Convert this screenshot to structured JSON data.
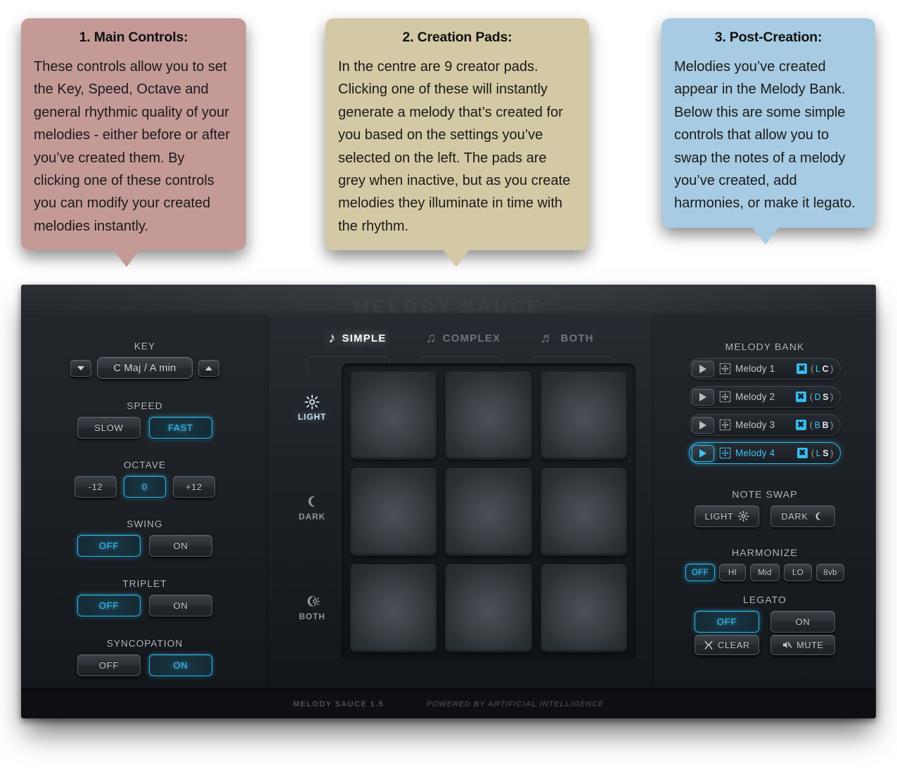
{
  "colors": {
    "accent_blue": "#3fc3f5",
    "callout1_bg": "#c49a96",
    "callout2_bg": "#d3c9a4",
    "callout3_bg": "#a7cbe2"
  },
  "callouts": [
    {
      "id": "main-controls",
      "title": "1. Main Controls:",
      "body": "These controls allow you to set the Key, Speed, Octave and general rhythmic quality of your melodies - either before or after you’ve created them. By clicking one of these controls you can modify your created melodies instantly.",
      "bg": "#c49a96"
    },
    {
      "id": "creation-pads",
      "title": "2. Creation Pads:",
      "body": "In the centre are 9 creator pads. Clicking one of these will instantly generate a melody that’s created for you based on the settings you’ve selected on the left.  The pads are grey when inactive, but as you create melodies they illuminate in time with the rhythm.",
      "bg": "#d3c9a4"
    },
    {
      "id": "post-creation",
      "title": "3. Post-Creation:",
      "body": "Melodies you’ve created appear in the Melody Bank.  Below this are some simple controls that allow you to swap the notes of a melody you’ve created, add harmonies, or make it legato.",
      "bg": "#a7cbe2"
    }
  ],
  "plugin": {
    "logo_watermark": "MELODY SAUCE",
    "footer": {
      "product": "MELODY SAUCE 1.5",
      "tagline": "POWERED BY ARTIFICIAL INTELLIGENCE"
    }
  },
  "left_panel": {
    "key": {
      "label": "KEY",
      "value": "C Maj / A min",
      "prev_icon": "triangle-down-icon",
      "next_icon": "triangle-up-icon"
    },
    "speed": {
      "label": "SPEED",
      "options": [
        "SLOW",
        "FAST"
      ],
      "selected": "FAST"
    },
    "octave": {
      "label": "OCTAVE",
      "options": [
        "-12",
        "0",
        "+12"
      ],
      "selected": "0"
    },
    "swing": {
      "label": "SWING",
      "options": [
        "OFF",
        "ON"
      ],
      "selected": "OFF"
    },
    "triplet": {
      "label": "TRIPLET",
      "options": [
        "OFF",
        "ON"
      ],
      "selected": "OFF"
    },
    "syncopation": {
      "label": "SYNCOPATION",
      "options": [
        "OFF",
        "ON"
      ],
      "selected": "ON"
    }
  },
  "center_panel": {
    "tabs": [
      {
        "label": "SIMPLE",
        "icon": "single-eighth-note-icon",
        "glyph": "♪",
        "active": true
      },
      {
        "label": "COMPLEX",
        "icon": "beamed-two-notes-icon",
        "glyph": "♫",
        "active": false
      },
      {
        "label": "BOTH",
        "icon": "beamed-three-notes-icon",
        "glyph": "♬",
        "active": false
      }
    ],
    "row_labels": [
      {
        "label": "LIGHT",
        "icon": "sun-icon",
        "lit": true
      },
      {
        "label": "DARK",
        "icon": "moon-icon",
        "lit": false
      },
      {
        "label": "BOTH",
        "icon": "sun-moon-icon",
        "lit": false
      }
    ],
    "pads": [
      {
        "id": "pad-1",
        "row": "LIGHT",
        "col": "SIMPLE",
        "state": "inactive"
      },
      {
        "id": "pad-2",
        "row": "LIGHT",
        "col": "COMPLEX",
        "state": "inactive"
      },
      {
        "id": "pad-3",
        "row": "LIGHT",
        "col": "BOTH",
        "state": "inactive"
      },
      {
        "id": "pad-4",
        "row": "DARK",
        "col": "SIMPLE",
        "state": "inactive"
      },
      {
        "id": "pad-5",
        "row": "DARK",
        "col": "COMPLEX",
        "state": "inactive"
      },
      {
        "id": "pad-6",
        "row": "DARK",
        "col": "BOTH",
        "state": "inactive"
      },
      {
        "id": "pad-7",
        "row": "BOTH",
        "col": "SIMPLE",
        "state": "inactive"
      },
      {
        "id": "pad-8",
        "row": "BOTH",
        "col": "COMPLEX",
        "state": "inactive"
      },
      {
        "id": "pad-9",
        "row": "BOTH",
        "col": "BOTH",
        "state": "inactive"
      }
    ]
  },
  "right_panel": {
    "melody_bank": {
      "label": "MELODY BANK",
      "rows": [
        {
          "name": "Melody 1",
          "tag_a": "L",
          "tag_b": "C",
          "active": false,
          "drag_icon": "drag-handle-icon",
          "play_icon": "play-icon",
          "export_icon": "midi-drag-x-icon"
        },
        {
          "name": "Melody 2",
          "tag_a": "D",
          "tag_b": "S",
          "active": false,
          "drag_icon": "drag-handle-icon",
          "play_icon": "play-icon",
          "export_icon": "midi-drag-x-icon"
        },
        {
          "name": "Melody 3",
          "tag_a": "B",
          "tag_b": "B",
          "active": false,
          "drag_icon": "drag-handle-icon",
          "play_icon": "play-icon",
          "export_icon": "midi-drag-x-icon"
        },
        {
          "name": "Melody 4",
          "tag_a": "L",
          "tag_b": "S",
          "active": true,
          "drag_icon": "drag-handle-icon",
          "play_icon": "play-icon",
          "export_icon": "midi-drag-x-icon"
        }
      ]
    },
    "note_swap": {
      "label": "NOTE SWAP",
      "buttons": [
        {
          "label": "LIGHT",
          "icon": "sun-icon"
        },
        {
          "label": "DARK",
          "icon": "moon-icon"
        }
      ]
    },
    "harmonize": {
      "label": "HARMONIZE",
      "options": [
        "OFF",
        "HI",
        "Mid",
        "LO",
        "8vb"
      ],
      "selected": "OFF"
    },
    "legato": {
      "label": "LEGATO",
      "options": [
        "OFF",
        "ON"
      ],
      "selected": "OFF"
    },
    "actions": [
      {
        "label": "CLEAR",
        "icon": "clear-x-icon"
      },
      {
        "label": "MUTE",
        "icon": "mute-speaker-icon"
      }
    ]
  }
}
